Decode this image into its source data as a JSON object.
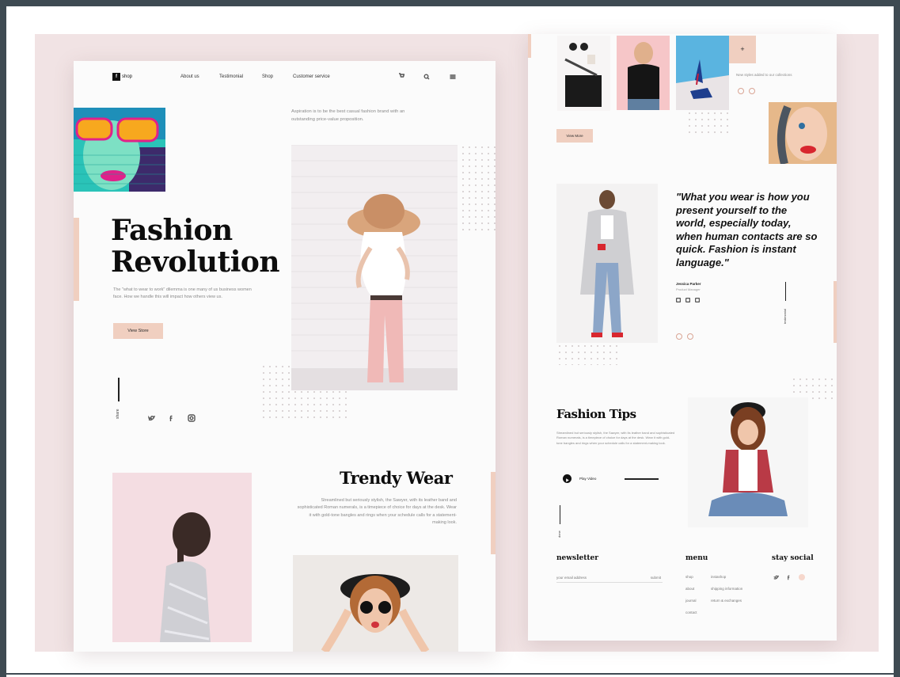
{
  "left_page": {
    "logo": {
      "mark": "f",
      "text": "shop"
    },
    "nav": [
      "About us",
      "Testimonial",
      "Shop",
      "Customer service"
    ],
    "icons": [
      "cart-icon",
      "search-icon",
      "menu-icon"
    ],
    "aspiration_text": "Aspiration is to be the best casual fashion brand with an outstanding price-value proposition.",
    "hero": {
      "title_line1": "Fashion",
      "title_line2": "Revolution",
      "body": "The \"what to wear to work\" dilemma is one many of us business women face. How we handle this will impact how others view us.",
      "button": "View Store"
    },
    "share_label": "share",
    "social_icons": [
      "twitter-icon",
      "facebook-icon",
      "instagram-icon"
    ],
    "trendy": {
      "title": "Trendy Wear",
      "body": "Streamlined but seriously stylish, the Sawyer, with its leather band and sophisticated Roman numerals, is a timepiece of choice for days at the desk. Wear it with gold-tone bangles and rings when your schedule calls for a statement-making look."
    }
  },
  "right_page": {
    "add_symbol": "+",
    "new_styles_text": "New styles added to our collections",
    "view_more": "View More",
    "quote": "\"What you wear is how you present yourself to the world, especially today, when human contacts are so quick. Fashion is instant language.\"",
    "author_name": "Jessica Parker",
    "author_role": "Product Manager",
    "testimonial_label": "testimonial",
    "fashion_tips": {
      "title": "Fashion Tips",
      "body": "Streamlined but seriously stylish, the Sawyer, with its leather band and sophisticated Roman numerals, is a timepiece of choice for days at the desk. Wear it with gold-tone bangles and rings when your schedule calls for a statement-making look.",
      "play_label": "Play Video"
    },
    "done_label": "done",
    "footer": {
      "newsletter_title": "newsletter",
      "email_placeholder": "your email address",
      "submit": "submit",
      "menu_title": "menu",
      "menu_col1": [
        "shop",
        "about",
        "journal",
        "contact"
      ],
      "menu_col2": [
        "instashop",
        "shipping information",
        "return & exchanges"
      ],
      "social_title": "stay social"
    }
  },
  "colors": {
    "accent": "#f0cfc0",
    "backdrop": "#f1e3e4",
    "frame": "#3e4a52"
  }
}
